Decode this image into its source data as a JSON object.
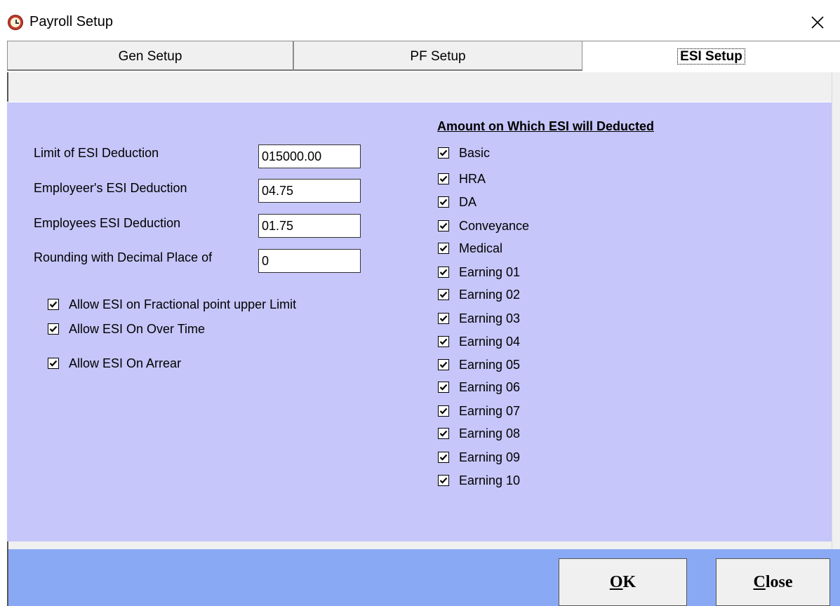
{
  "window": {
    "title": "Payroll Setup"
  },
  "tabs": [
    {
      "label": "Gen Setup"
    },
    {
      "label": "PF Setup"
    },
    {
      "label": "ESI Setup"
    }
  ],
  "form": {
    "limit_label": "Limit of ESI Deduction",
    "limit_value": "015000.00",
    "employer_label": "Employeer's ESI Deduction",
    "employer_value": "04.75",
    "employee_label": "Employees ESI Deduction",
    "employee_value": "01.75",
    "rounding_label": "Rounding with Decimal Place of",
    "rounding_value": "0"
  },
  "options": [
    {
      "label": "Allow ESI on Fractional point  upper Limit",
      "checked": true
    },
    {
      "label": "Allow ESI On Over Time",
      "checked": true
    },
    {
      "label": "Allow ESI On Arrear",
      "checked": true
    }
  ],
  "earnings": {
    "heading": "Amount on Which ESI will Deducted",
    "items": [
      {
        "label": "Basic",
        "checked": true
      },
      {
        "label": "HRA",
        "checked": true
      },
      {
        "label": "DA",
        "checked": true
      },
      {
        "label": "Conveyance",
        "checked": true
      },
      {
        "label": "Medical",
        "checked": true
      },
      {
        "label": "Earning 01",
        "checked": true
      },
      {
        "label": "Earning 02",
        "checked": true
      },
      {
        "label": "Earning 03",
        "checked": true
      },
      {
        "label": "Earning 04",
        "checked": true
      },
      {
        "label": "Earning 05",
        "checked": true
      },
      {
        "label": "Earning 06",
        "checked": true
      },
      {
        "label": "Earning 07",
        "checked": true
      },
      {
        "label": "Earning 08",
        "checked": true
      },
      {
        "label": "Earning 09",
        "checked": true
      },
      {
        "label": "Earning 10",
        "checked": true
      }
    ]
  },
  "buttons": {
    "ok_first": "O",
    "ok_rest": "K",
    "close_first": "C",
    "close_rest": "lose"
  },
  "icons": {
    "app": "clock-icon",
    "close": "close-icon",
    "check": "checkmark-icon"
  }
}
